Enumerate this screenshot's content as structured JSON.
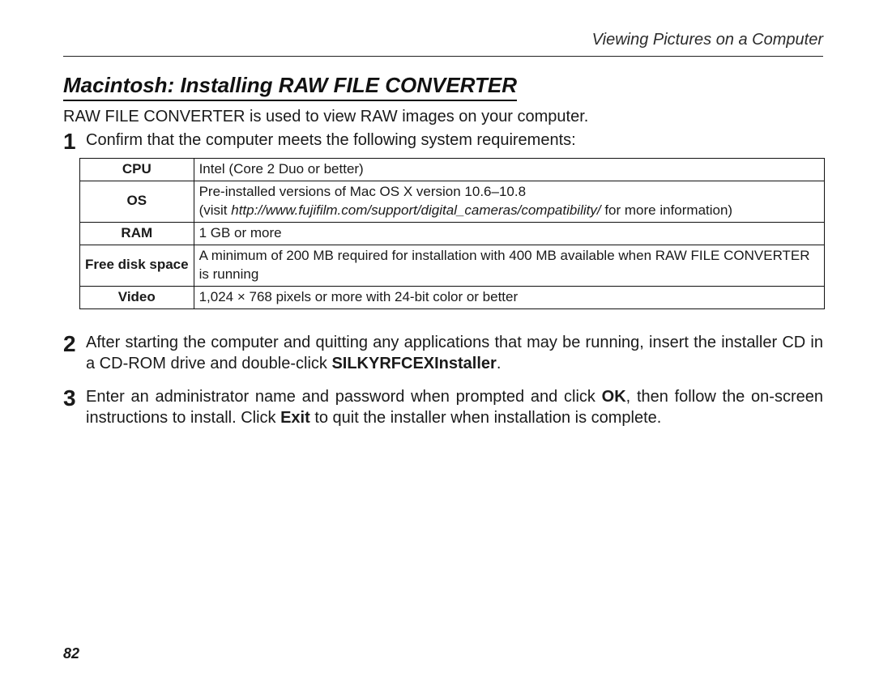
{
  "runningHead": "Viewing Pictures on a Computer",
  "heading": "Macintosh: Installing RAW FILE CONVERTER",
  "intro": "RAW FILE CONVERTER is used to view RAW images on your computer.",
  "step1": {
    "num": "1",
    "text": "Confirm that the computer meets the following system requirements:"
  },
  "requirements": {
    "cpu_label": "CPU",
    "cpu": "Intel (Core 2 Duo or better)",
    "os_label": "OS",
    "os_before": "Pre-installed versions of Mac OS X version 10.6–10.8\n(visit ",
    "os_url": "http://www.fujifilm.com/support/digital_cameras/compatibility/",
    "os_after": " for more information)",
    "ram_label": "RAM",
    "ram": "1 GB or more",
    "disk_label": "Free disk space",
    "disk": "A minimum of 200 MB required for installation with 400 MB available when RAW FILE CONVERTER is running",
    "video_label": "Video",
    "video": "1,024 × 768 pixels or more with 24-bit color or better"
  },
  "step2": {
    "num": "2",
    "before": "After starting the computer and quitting any applications that may be running, insert the installer CD in a CD-ROM drive and double-click ",
    "bold": "SILKYRFCEXInstaller",
    "after": "."
  },
  "step3": {
    "num": "3",
    "before": "Enter an administrator name and password when prompted and click ",
    "bold1": "OK",
    "mid": ", then follow the on-screen instructions to install.  Click ",
    "bold2": "Exit",
    "after": " to quit the installer when installation is complete."
  },
  "pageNumber": "82"
}
